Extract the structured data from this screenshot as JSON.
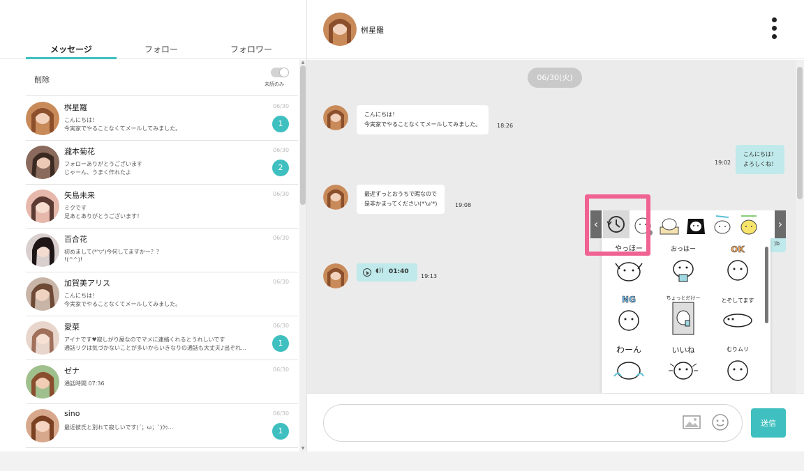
{
  "tabs": {
    "messages": "メッセージ",
    "follow": "フォロー",
    "followers": "フォロワー"
  },
  "list": {
    "delete_label": "削除",
    "unread_only_label": "未読のみ",
    "conversations": [
      {
        "name": "桝星羅",
        "line1": "こんにちは！",
        "line2": "今実家でやることなくてメールしてみました。",
        "date": "06/30",
        "badge": "1",
        "avatar_color": "#c98a5a"
      },
      {
        "name": "瀧本菊花",
        "line1": "フォローありがとうございます",
        "line2": "じゃーん、うまく作れたよ",
        "date": "06/30",
        "badge": "2",
        "avatar_color": "#8a6a5c"
      },
      {
        "name": "矢島未来",
        "line1": "ミクです",
        "line2": "足あとありがとうございます！",
        "date": "06/30",
        "badge": "",
        "avatar_color": "#d39a8e"
      },
      {
        "name": "百合花",
        "line1": "初めまして(*'▽')今何してますかー？？",
        "line2": "!(^^)!",
        "date": "06/30",
        "badge": "",
        "avatar_color": "#4a3c3c"
      },
      {
        "name": "加賀美アリス",
        "line1": "こんにちは！",
        "line2": "今実家でやることなくてメールしてみました。",
        "date": "06/30",
        "badge": "",
        "avatar_color": "#b08a72"
      },
      {
        "name": "愛菜",
        "line1": "アイナです♥寂しがり屋なのでマメに連絡くれるとうれしいです",
        "line2": "通話リクは気づかないことが多いからいきなりの通話も大丈夫♪出ぞれ…",
        "date": "06/30",
        "badge": "1",
        "avatar_color": "#c9a090"
      },
      {
        "name": "ゼナ",
        "line1": "通話時間 07:36",
        "line2": "",
        "date": "06/30",
        "badge": "",
        "avatar_color": "#b7826a"
      },
      {
        "name": "sino",
        "line1": "最近彼氏と別れて寂しいです(´；ω；`)ｳｩ…",
        "line2": "",
        "date": "06/30",
        "badge": "1",
        "avatar_color": "#d09878"
      }
    ]
  },
  "chat": {
    "partner_name": "桝星羅",
    "date_chip": "06/30(火)",
    "messages": [
      {
        "line1": "こんにちは！",
        "line2": "今実家でやることなくてメールしてみました。",
        "time": "18:26"
      },
      {
        "line1": "こんにちは！",
        "line2": "よろしくね！",
        "time": "19:02"
      },
      {
        "line1": "最近ずっとおうちで暇なので",
        "line2": "是非かまってください(*'ω'*)",
        "time": "19:08"
      },
      {
        "partial_text": ")b"
      },
      {
        "audio_duration": "01:40",
        "time": "19:13"
      }
    ]
  },
  "sticker_panel": {
    "stickers": [
      "やっほー",
      "おっはー",
      "OK",
      "NG",
      "ちょっとだけー",
      "とぞしてます",
      "わーん",
      "いいね",
      "むりムリ"
    ],
    "icons": [
      "history-icon",
      "chevron-left-icon",
      "chevron-right-icon"
    ]
  },
  "composer": {
    "placeholder": "",
    "send_label": "送信",
    "icons": [
      "image-icon",
      "emoji-icon"
    ]
  },
  "colors": {
    "accent": "#3fbfbf",
    "bubble_mine": "#bfe9ea",
    "highlight": "#f06292",
    "chat_bg": "#ebebeb"
  }
}
